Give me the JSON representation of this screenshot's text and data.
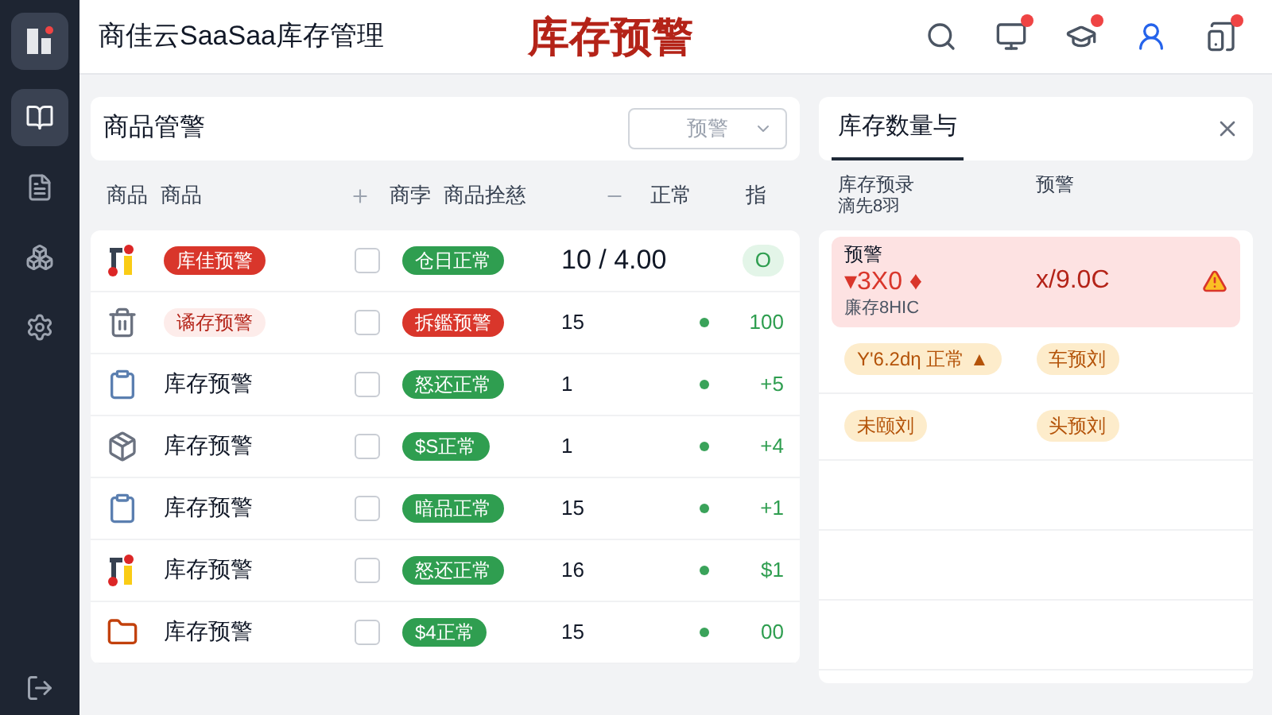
{
  "app": {
    "title": "商佳云SaaSaa库存管理",
    "page_title": "库存预警"
  },
  "header_icons": [
    {
      "kind": "search",
      "badge": false
    },
    {
      "kind": "monitor",
      "badge": true
    },
    {
      "kind": "cap",
      "badge": true
    },
    {
      "kind": "user",
      "badge": false
    },
    {
      "kind": "tablet",
      "badge": true
    }
  ],
  "sidebar": {
    "items": [
      {
        "kind": "book",
        "selected": true
      },
      {
        "kind": "file",
        "selected": false
      },
      {
        "kind": "nodes",
        "selected": false
      },
      {
        "kind": "settings",
        "selected": false
      }
    ]
  },
  "goods": {
    "title": "商品管警",
    "filter": {
      "value": "预警"
    },
    "columns": [
      {
        "label": "商品",
        "kind": "text"
      },
      {
        "label": "商品",
        "kind": "text"
      },
      {
        "kind": "plus"
      },
      {
        "label": "商孛",
        "kind": "text"
      },
      {
        "label": "商品拴慈",
        "kind": "text"
      },
      {
        "kind": "minus"
      },
      {
        "label": "正常",
        "kind": "text"
      },
      {
        "label": "指",
        "kind": "text"
      }
    ],
    "rows": [
      {
        "name": {
          "text": "库佳预警",
          "kind": "danger"
        },
        "checked": false,
        "status": {
          "text": "仓日正常",
          "kind": "ok"
        },
        "qty": "10 / 4.00",
        "trail": {
          "text": "O",
          "kind": "pill"
        }
      },
      {
        "name": {
          "text": "谲存预警",
          "kind": "soft"
        },
        "checked": false,
        "status": {
          "text": "拆鑑预警",
          "kind": "alert"
        },
        "qty": "15",
        "trail": {
          "text": "100",
          "kind": "dot"
        }
      },
      {
        "name": {
          "text": "库存预警",
          "kind": "plain"
        },
        "checked": false,
        "status": {
          "text": "怒还正常",
          "kind": "ok"
        },
        "qty": "1",
        "trail": {
          "text": "+5",
          "kind": "dot"
        }
      },
      {
        "name": {
          "text": "库存预警",
          "kind": "plain"
        },
        "checked": false,
        "status": {
          "text": "$S正常",
          "kind": "ok"
        },
        "qty": "1",
        "trail": {
          "text": "+4",
          "kind": "dot"
        }
      },
      {
        "name": {
          "text": "库存预警",
          "kind": "plain"
        },
        "checked": false,
        "status": {
          "text": "暗品正常",
          "kind": "ok"
        },
        "qty": "15",
        "trail": {
          "text": "+1",
          "kind": "dot"
        }
      },
      {
        "name": {
          "text": "库存预警",
          "kind": "plain"
        },
        "checked": false,
        "status": {
          "text": "怒还正常",
          "kind": "ok"
        },
        "qty": "16",
        "trail": {
          "text": "$1",
          "kind": "dot"
        }
      },
      {
        "name": {
          "text": "库存预警",
          "kind": "plain"
        },
        "checked": false,
        "status": {
          "text": "$4正常",
          "kind": "ok"
        },
        "qty": "15",
        "trail": {
          "text": "00",
          "kind": "dot"
        }
      }
    ]
  },
  "stock": {
    "tab": "库存数量与",
    "columns": [
      {
        "label": "库存预录",
        "sub": "滴先8羽"
      },
      {
        "label": "预警"
      }
    ],
    "rows": [
      {
        "kind": "alert",
        "label": "预警",
        "value": "▾3X0 ♦",
        "note": "廉存8HIC",
        "right": "x/9.0C"
      },
      {
        "kind": "tags",
        "left": [
          "Y'6.2dη 正常 ▲"
        ],
        "right": [
          "车预刘"
        ]
      },
      {
        "kind": "tags",
        "left": [
          "未颐刘"
        ],
        "right": [
          "头预刘"
        ]
      },
      {
        "kind": "empty"
      },
      {
        "kind": "empty"
      },
      {
        "kind": "empty"
      }
    ]
  }
}
